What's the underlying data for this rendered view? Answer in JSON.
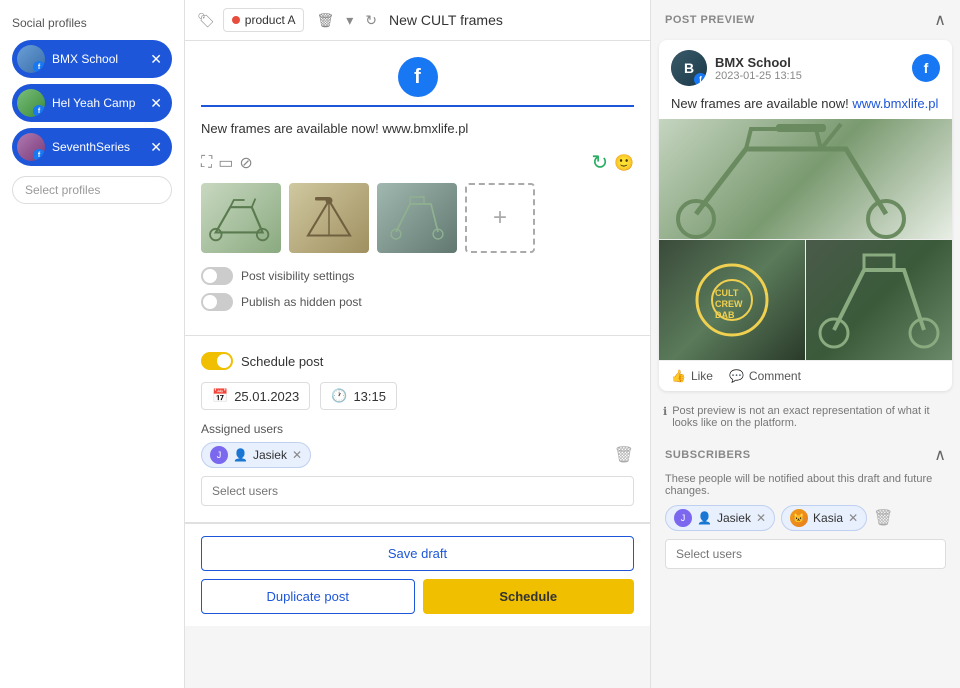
{
  "sidebar": {
    "title": "Social profiles",
    "profiles": [
      {
        "name": "BMX School",
        "id": "bmx-school"
      },
      {
        "name": "Hel Yeah Camp",
        "id": "hel-yeah-camp"
      },
      {
        "name": "SeventhSeries",
        "id": "seventh-series"
      }
    ],
    "select_placeholder": "Select profiles"
  },
  "topbar": {
    "product_label": "product A",
    "title": "New CULT frames"
  },
  "editor": {
    "post_text": "New frames are available now! www.bmxlife.pl",
    "add_image_label": "+",
    "visibility_label": "Post visibility settings",
    "hidden_label": "Publish as hidden post"
  },
  "schedule": {
    "toggle_label": "Schedule post",
    "date": "25.01.2023",
    "time": "13:15",
    "assigned_label": "Assigned users",
    "assigned_users": [
      {
        "name": "Jasiek",
        "id": "jasiek"
      }
    ],
    "select_users_placeholder": "Select users"
  },
  "actions": {
    "save_draft": "Save draft",
    "duplicate": "Duplicate post",
    "schedule": "Schedule"
  },
  "preview": {
    "title": "POST PREVIEW",
    "account_name": "BMX School",
    "account_date": "2023-01-25 13:15",
    "post_text": "New frames are available now! ",
    "post_link": "www.bmxlife.pl",
    "like_label": "Like",
    "comment_label": "Comment",
    "note": "Post preview is not an exact representation of what it looks like on the platform."
  },
  "subscribers": {
    "title": "SUBSCRIBERS",
    "description": "These people will be notified about this draft and future changes.",
    "users": [
      {
        "name": "Jasiek",
        "type": "purple"
      },
      {
        "name": "Kasia",
        "type": "orange"
      }
    ],
    "select_placeholder": "Select users"
  }
}
